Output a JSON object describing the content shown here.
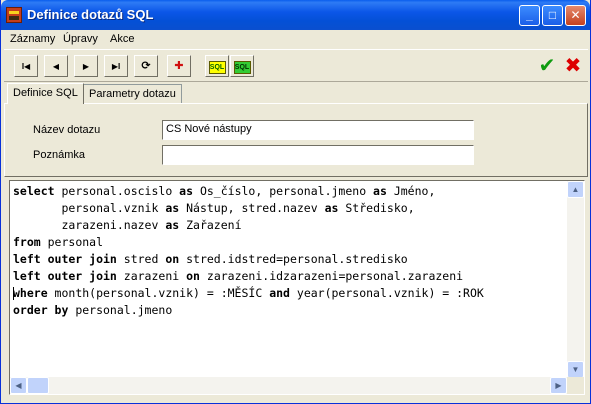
{
  "window": {
    "title": "Definice dotazů SQL",
    "controls": {
      "minimize": "_",
      "maximize": "□",
      "close": "✕"
    }
  },
  "menu": [
    "Záznamy",
    "Úpravy",
    "Akce"
  ],
  "toolbar": {
    "first": "I◀",
    "prev": "◀",
    "next": "▶",
    "last": "▶I",
    "refresh": "⟳",
    "insert": "✚",
    "sql_badge_1": "SQL",
    "sql_badge_2": "SQL",
    "ok": "✔",
    "cancel": "✖"
  },
  "tabs": [
    "Definice SQL",
    "Parametry dotazu"
  ],
  "form": {
    "name_label": "Název dotazu",
    "name_value": "CS Nové nástupy",
    "note_label": "Poznámka",
    "note_value": ""
  },
  "editor": {
    "lines": [
      [
        "select",
        " personal.oscislo ",
        "as",
        " Os_číslo, personal.jmeno ",
        "as",
        " Jméno,"
      ],
      [
        "       personal.vznik ",
        "as",
        " Nástup, stred.nazev ",
        "as",
        " Středisko,"
      ],
      [
        "       zarazeni.nazev ",
        "as",
        " Zařazení"
      ],
      [
        "from",
        " personal"
      ],
      [
        "left outer join",
        " stred ",
        "on",
        " stred.idstred=personal.stredisko"
      ],
      [
        "left outer join",
        " zarazeni ",
        "on",
        " zarazeni.idzarazeni=personal.zarazeni"
      ],
      [
        "where",
        " month(personal.vznik) = :MĚSÍC ",
        "and",
        " year(personal.vznik) = :ROK"
      ],
      [
        "order by",
        " personal.jmeno"
      ]
    ]
  },
  "colors": {
    "titlebar": "#0450d6",
    "window_bg": "#ece9d8",
    "ok_green": "#0f9b0f",
    "cancel_red": "#dd0000"
  }
}
